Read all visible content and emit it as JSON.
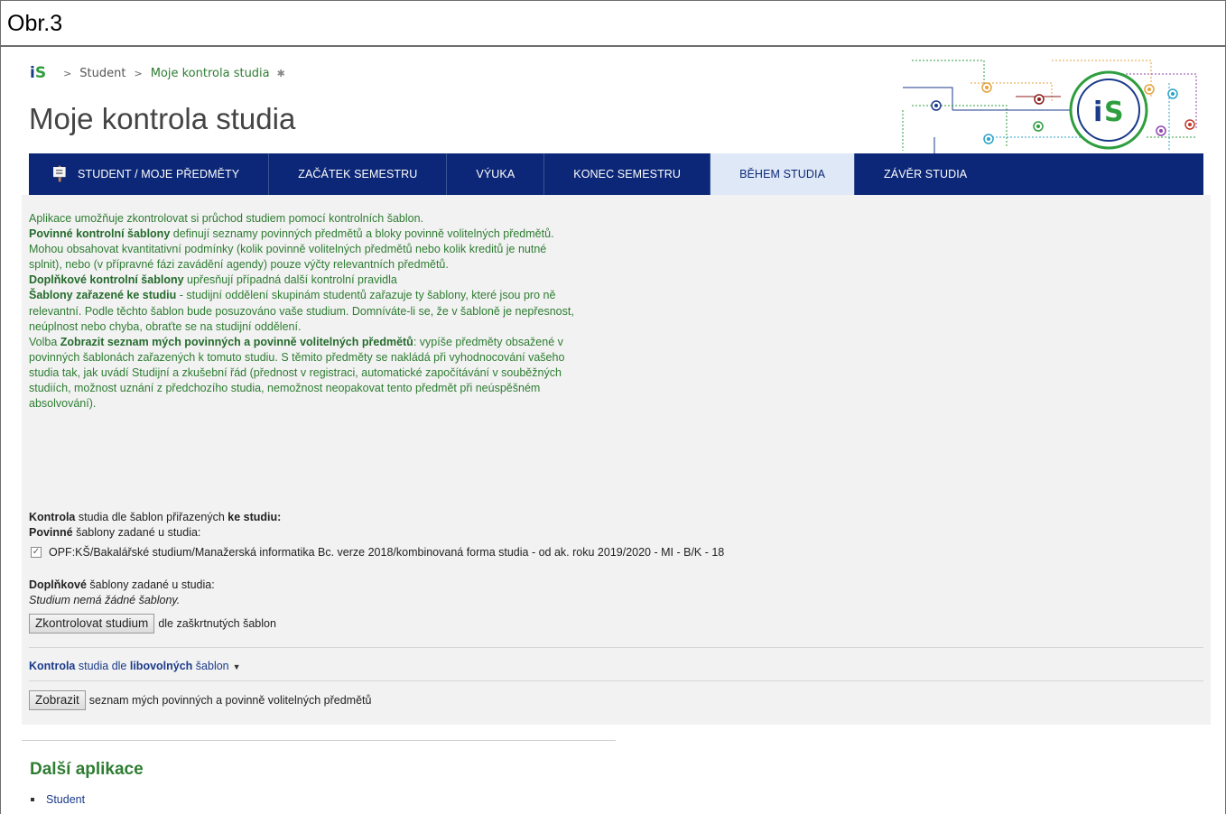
{
  "figure_label": "Obr.3",
  "breadcrumb": {
    "logo_text_i": "i",
    "logo_text_s": "S",
    "items": [
      "Student",
      "Moje kontrola studia"
    ]
  },
  "page_title": "Moje kontrola studia",
  "nav": {
    "items": [
      {
        "label": "STUDENT / MOJE PŘEDMĚTY",
        "active": false
      },
      {
        "label": "ZAČÁTEK SEMESTRU",
        "active": false
      },
      {
        "label": "VÝUKA",
        "active": false
      },
      {
        "label": "KONEC SEMESTRU",
        "active": false
      },
      {
        "label": "BĚHEM STUDIA",
        "active": true
      },
      {
        "label": "ZÁVĚR STUDIA",
        "active": false
      }
    ]
  },
  "intro": {
    "p1": "Aplikace umožňuje zkontrolovat si průchod studiem pomocí kontrolních šablon.",
    "p2_bold": "Povinné kontrolní šablony",
    "p2_rest": " definují seznamy povinných předmětů a bloky povinně volitelných předmětů. Mohou obsahovat kvantitativní podmínky (kolik povinně volitelných předmětů nebo kolik kreditů je nutné splnit), nebo (v přípravné fázi zavádění agendy) pouze výčty relevantních předmětů.",
    "p3_bold": "Doplňkové kontrolní šablony",
    "p3_rest": " upřesňují případná další kontrolní pravidla",
    "p4_bold": "Šablony zařazené ke studiu",
    "p4_rest": " - studijní oddělení skupinám studentů zařazuje ty šablony, které jsou pro ně relevantní. Podle těchto šablon bude posuzováno vaše studium. Domníváte-li se, že v šabloně je nepřesnost, neúplnost nebo chyba, obraťte se na studijní oddělení.",
    "p5_start": "Volba ",
    "p5_bold": "Zobrazit seznam mých povinných a povinně volitelných předmětů",
    "p5_rest": ": vypíše předměty obsažené v povinných šablonách zařazených k tomuto studiu. S těmito předměty se nakládá při vyhodnocování vašeho studia tak, jak uvádí Studijní a zkušební řád (přednost v registraci, automatické započítávání v souběžných studiích, možnost uznání z předchozího studia, nemožnost neopakovat tento předmět při neúspěšném absolvování)."
  },
  "check": {
    "heading_bold1": "Kontrola",
    "heading_mid": " studia dle šablon přiřazených ",
    "heading_bold2": "ke studiu:",
    "mandatory_bold": "Povinné",
    "mandatory_rest": " šablony zadané u studia:",
    "template_label": "OPF:KŠ/Bakalářské studium/Manažerská informatika Bc. verze 2018/kombinovaná forma studia - od ak. roku 2019/2020 - MI - B/K - 18",
    "template_checked": true,
    "supplementary_bold": "Doplňkové",
    "supplementary_rest": " šablony zadané u studia:",
    "no_templates": "Studium nemá žádné šablony.",
    "check_button": "Zkontrolovat studium",
    "check_after": "dle zaškrtnutých šablon"
  },
  "arbitrary": {
    "bold1": "Kontrola",
    "mid": " studia dle ",
    "bold2": "libovolných",
    "rest": " šablon"
  },
  "show": {
    "button": "Zobrazit",
    "after": "seznam mých povinných a povinně volitelných předmětů"
  },
  "further": {
    "title": "Další aplikace",
    "items": [
      "Student"
    ]
  },
  "colors": {
    "nav_bg": "#0c2777",
    "nav_active_bg": "#dfe8f7",
    "green_text": "#2e7d32",
    "panel_bg": "#f2f2f2"
  }
}
